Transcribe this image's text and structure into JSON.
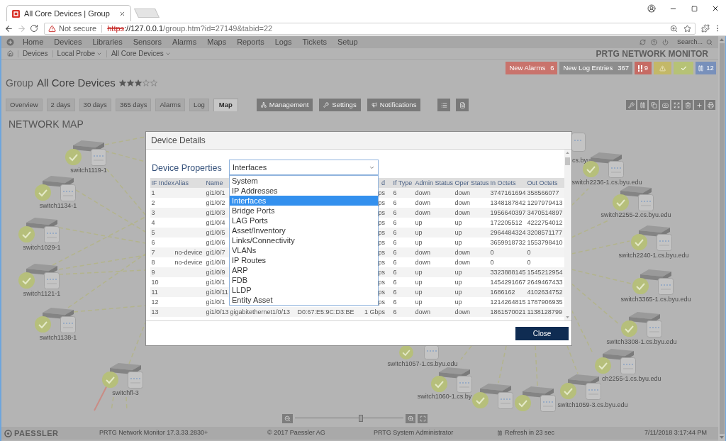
{
  "browser": {
    "tab_title": "All Core Devices | Group",
    "security_label": "Not secure",
    "url_scheme": "https",
    "url_host": "://127.0.0.1",
    "url_path": "/group.htm?id=27149&tabid=22"
  },
  "nav": {
    "items": [
      "Home",
      "Devices",
      "Libraries",
      "Sensors",
      "Alarms",
      "Maps",
      "Reports",
      "Logs",
      "Tickets",
      "Setup"
    ],
    "search_placeholder": "Search..."
  },
  "breadcrumb": [
    {
      "label": "Devices",
      "dropdown": false
    },
    {
      "label": "Local Probe",
      "dropdown": true
    },
    {
      "label": "All Core Devices",
      "dropdown": true
    }
  ],
  "brand": "PRTG NETWORK MONITOR",
  "alerts": [
    {
      "label": "New Alarms",
      "count": "6",
      "color": "#c9736c"
    },
    {
      "label": "New Log Entries",
      "count": "367",
      "color": "#8d8d8d"
    }
  ],
  "status_boxes": [
    {
      "kind": "down",
      "text": "9",
      "color": "#c66b64"
    },
    {
      "kind": "warning",
      "color": "#c3b868"
    },
    {
      "kind": "up",
      "color": "#b6c276"
    },
    {
      "kind": "paused",
      "text": "12",
      "color": "#7890bb"
    }
  ],
  "page_title": {
    "kind_label": "Group",
    "name": "All Core Devices",
    "stars": 3
  },
  "tabs": [
    {
      "label": "Overview",
      "selected": false
    },
    {
      "label": "2 days",
      "selected": false
    },
    {
      "label": "30 days",
      "selected": false
    },
    {
      "label": "365 days",
      "selected": false
    },
    {
      "label": "Alarms",
      "selected": false
    },
    {
      "label": "Log",
      "selected": false
    },
    {
      "label": "Map",
      "selected": true
    }
  ],
  "actions": [
    "Management",
    "Settings",
    "Notifications"
  ],
  "map": {
    "title": "NETWORK MAP",
    "nodes": [
      "switch1119-1",
      "switch1134-1",
      "switch1029-1",
      "switch1121-1",
      "switch1138-1",
      "switchfl-3",
      "cs.byu",
      "switch2236-1.cs.byu.edu",
      "switch2255-2.cs.byu.edu",
      "switch2240-1.cs.byu.edu",
      "switch3365-1.cs.byu.edu",
      "switch3308-1.cs.byu.edu",
      "switch1057-1.cs.byu.edu",
      "ch2255-1.cs.byu.edu",
      "switch1060-1.cs.by",
      "switch1059-3.cs.byu.edu"
    ],
    "zoom": {
      "level": 0.61
    }
  },
  "modal": {
    "title": "Device Details",
    "heading": "Device Properties",
    "select": {
      "value": "Interfaces",
      "expanded": true,
      "options": [
        {
          "label": "System",
          "selected": false
        },
        {
          "label": "IP Addresses",
          "selected": false
        },
        {
          "label": "Interfaces",
          "selected": true
        },
        {
          "label": "Bridge Ports",
          "selected": false
        },
        {
          "label": "LAG Ports",
          "selected": false
        },
        {
          "label": "Asset/Inventory",
          "selected": false
        },
        {
          "label": "Links/Connectivity",
          "selected": false
        },
        {
          "label": "VLANs",
          "selected": false
        },
        {
          "label": "IP Routes",
          "selected": false
        },
        {
          "label": "ARP",
          "selected": false
        },
        {
          "label": "FDB",
          "selected": false
        },
        {
          "label": "LLDP",
          "selected": false
        },
        {
          "label": "Entity Asset",
          "selected": false
        }
      ]
    },
    "table": {
      "columns": [
        "IF Index",
        "Alias",
        "Name",
        null,
        null,
        "d",
        "If Type",
        "Admin Status",
        "Oper Status",
        "In Octets",
        "Out Octets"
      ],
      "rows": [
        [
          "1",
          null,
          "gi1/0/1",
          null,
          null,
          "ps",
          "6",
          "down",
          "down",
          "3747161694",
          "358566077"
        ],
        [
          "2",
          null,
          "gi1/0/2",
          null,
          null,
          "ps",
          "6",
          "down",
          "down",
          "1348187842",
          "1297979413"
        ],
        [
          "3",
          null,
          "gi1/0/3",
          null,
          null,
          "ps",
          "6",
          "down",
          "down",
          "1956640397",
          "3470514897"
        ],
        [
          "4",
          null,
          "gi1/0/4",
          null,
          null,
          "ps",
          "6",
          "up",
          "up",
          "172205512",
          "4222754012"
        ],
        [
          "5",
          null,
          "gi1/0/5",
          null,
          null,
          "ps",
          "6",
          "up",
          "up",
          "2964484324",
          "3208571177"
        ],
        [
          "6",
          null,
          "gi1/0/6",
          null,
          null,
          "ps",
          "6",
          "up",
          "up",
          "3659918732",
          "1553798410"
        ],
        [
          "7",
          "no-device",
          "gi1/0/7",
          null,
          null,
          "ps",
          "6",
          "down",
          "down",
          "0",
          "0"
        ],
        [
          "8",
          "no-device",
          "gi1/0/8",
          null,
          null,
          "ps",
          "6",
          "down",
          "down",
          "0",
          "0"
        ],
        [
          "9",
          null,
          "gi1/0/9",
          null,
          null,
          "ps",
          "6",
          "up",
          "up",
          "3323888145",
          "1545212954"
        ],
        [
          "10",
          null,
          "gi1/0/1",
          null,
          null,
          "ps",
          "6",
          "up",
          "up",
          "1454291667",
          "2649467433"
        ],
        [
          "11",
          null,
          "gi1/0/11",
          null,
          null,
          "ps",
          "6",
          "up",
          "up",
          "1686162",
          "4102634752"
        ],
        [
          "12",
          null,
          "gi1/0/1",
          null,
          null,
          "ps",
          "6",
          "up",
          "up",
          "1214264815",
          "1787906935"
        ],
        [
          "13",
          null,
          "gi1/0/13",
          "gigabitethernet1/0/13",
          "D0:67:E5:9C:D3:BE",
          "1 Gbps",
          "6",
          "down",
          "down",
          "1861570021",
          "1138128799"
        ]
      ]
    },
    "close_label": "Close"
  },
  "status_bar": {
    "logo": "PAESSLER",
    "items": [
      "PRTG Network Monitor 17.3.33.2830+",
      "© 2017 Paessler AG",
      "PRTG System Administrator",
      "Refresh in 23 sec",
      "7/11/2018 3:17:44 PM"
    ]
  }
}
